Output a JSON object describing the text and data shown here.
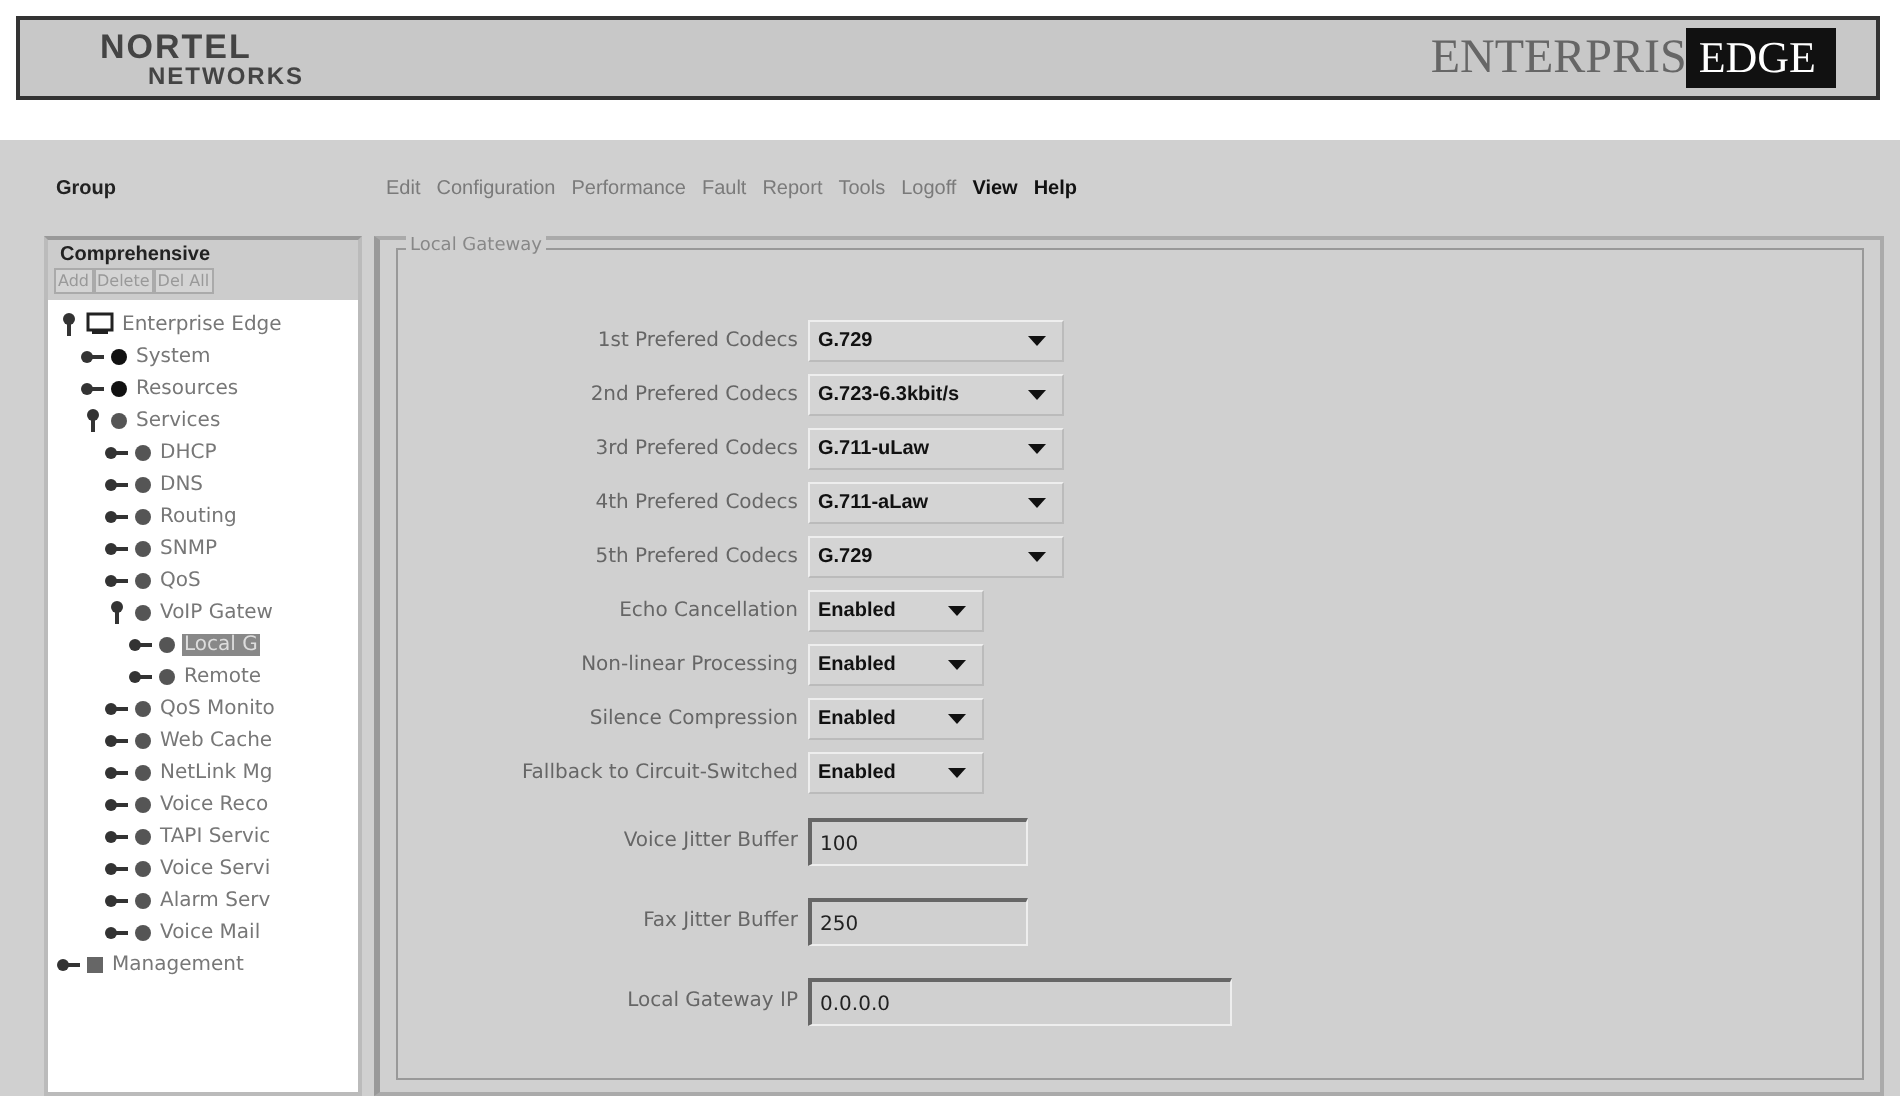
{
  "header": {
    "logo_top": "NORTEL",
    "logo_bottom": "NETWORKS",
    "product_left": "ENTERPRIS",
    "product_right": "EDGE"
  },
  "group_label": "Group",
  "menu": [
    {
      "label": "Edit",
      "disabled": true
    },
    {
      "label": "Configuration",
      "disabled": true
    },
    {
      "label": "Performance",
      "disabled": true
    },
    {
      "label": "Fault",
      "disabled": true
    },
    {
      "label": "Report",
      "disabled": true
    },
    {
      "label": "Tools",
      "disabled": true
    },
    {
      "label": "Logoff",
      "disabled": true
    },
    {
      "label": "View",
      "disabled": false
    },
    {
      "label": "Help",
      "disabled": false
    }
  ],
  "sidebar": {
    "title": "Comprehensive",
    "buttons": [
      {
        "label": "Add",
        "disabled": true
      },
      {
        "label": "Delete",
        "disabled": true
      },
      {
        "label": "Del All",
        "disabled": true
      }
    ],
    "tree": [
      {
        "label": "Enterprise Edge",
        "kind": "folder",
        "expanded": true,
        "selected": false,
        "children": [
          {
            "label": "System",
            "kind": "dark",
            "expanded": false,
            "selected": false
          },
          {
            "label": "Resources",
            "kind": "dark",
            "expanded": false,
            "selected": false
          },
          {
            "label": "Services",
            "kind": "ball",
            "expanded": true,
            "selected": false,
            "children": [
              {
                "label": "DHCP",
                "kind": "ball",
                "expanded": false,
                "selected": false
              },
              {
                "label": "DNS",
                "kind": "ball",
                "expanded": false,
                "selected": false
              },
              {
                "label": "Routing",
                "kind": "ball",
                "expanded": false,
                "selected": false
              },
              {
                "label": "SNMP",
                "kind": "ball",
                "expanded": false,
                "selected": false
              },
              {
                "label": "QoS",
                "kind": "ball",
                "expanded": false,
                "selected": false
              },
              {
                "label": "VoIP Gatew",
                "kind": "ball",
                "expanded": true,
                "selected": false,
                "children": [
                  {
                    "label": "Local G",
                    "kind": "ball",
                    "expanded": false,
                    "selected": true
                  },
                  {
                    "label": "Remote",
                    "kind": "ball",
                    "expanded": false,
                    "selected": false
                  }
                ]
              },
              {
                "label": "QoS Monito",
                "kind": "ball",
                "expanded": false,
                "selected": false
              },
              {
                "label": "Web Cache",
                "kind": "ball",
                "expanded": false,
                "selected": false
              },
              {
                "label": "NetLink Mg",
                "kind": "ball",
                "expanded": false,
                "selected": false
              },
              {
                "label": "Voice Reco",
                "kind": "ball",
                "expanded": false,
                "selected": false
              },
              {
                "label": "TAPI Servic",
                "kind": "ball",
                "expanded": false,
                "selected": false
              },
              {
                "label": "Voice Servi",
                "kind": "ball",
                "expanded": false,
                "selected": false
              },
              {
                "label": "Alarm Serv",
                "kind": "ball",
                "expanded": false,
                "selected": false
              },
              {
                "label": "Voice Mail",
                "kind": "ball",
                "expanded": false,
                "selected": false
              }
            ]
          }
        ]
      },
      {
        "label": "Management",
        "kind": "square",
        "expanded": false,
        "selected": false
      }
    ]
  },
  "panel": {
    "title": "Local Gateway",
    "fields": [
      {
        "kind": "codec",
        "label": "1st Prefered Codecs",
        "value": "G.729"
      },
      {
        "kind": "codec",
        "label": "2nd Prefered Codecs",
        "value": "G.723-6.3kbit/s"
      },
      {
        "kind": "codec",
        "label": "3rd Prefered Codecs",
        "value": "G.711-uLaw"
      },
      {
        "kind": "codec",
        "label": "4th Prefered Codecs",
        "value": "G.711-aLaw"
      },
      {
        "kind": "codec",
        "label": "5th Prefered Codecs",
        "value": "G.729"
      },
      {
        "kind": "toggle",
        "label": "Echo Cancellation",
        "value": "Enabled"
      },
      {
        "kind": "toggle",
        "label": "Non-linear Processing",
        "value": "Enabled"
      },
      {
        "kind": "toggle",
        "label": "Silence Compression",
        "value": "Enabled"
      },
      {
        "kind": "toggle",
        "label": "Fallback to Circuit-Switched",
        "value": "Enabled"
      },
      {
        "kind": "number",
        "label": "Voice Jitter Buffer",
        "value": "100"
      },
      {
        "kind": "number",
        "label": "Fax Jitter Buffer",
        "value": "250"
      },
      {
        "kind": "address",
        "label": "Local Gateway IP",
        "value": "0.0.0.0"
      }
    ]
  }
}
